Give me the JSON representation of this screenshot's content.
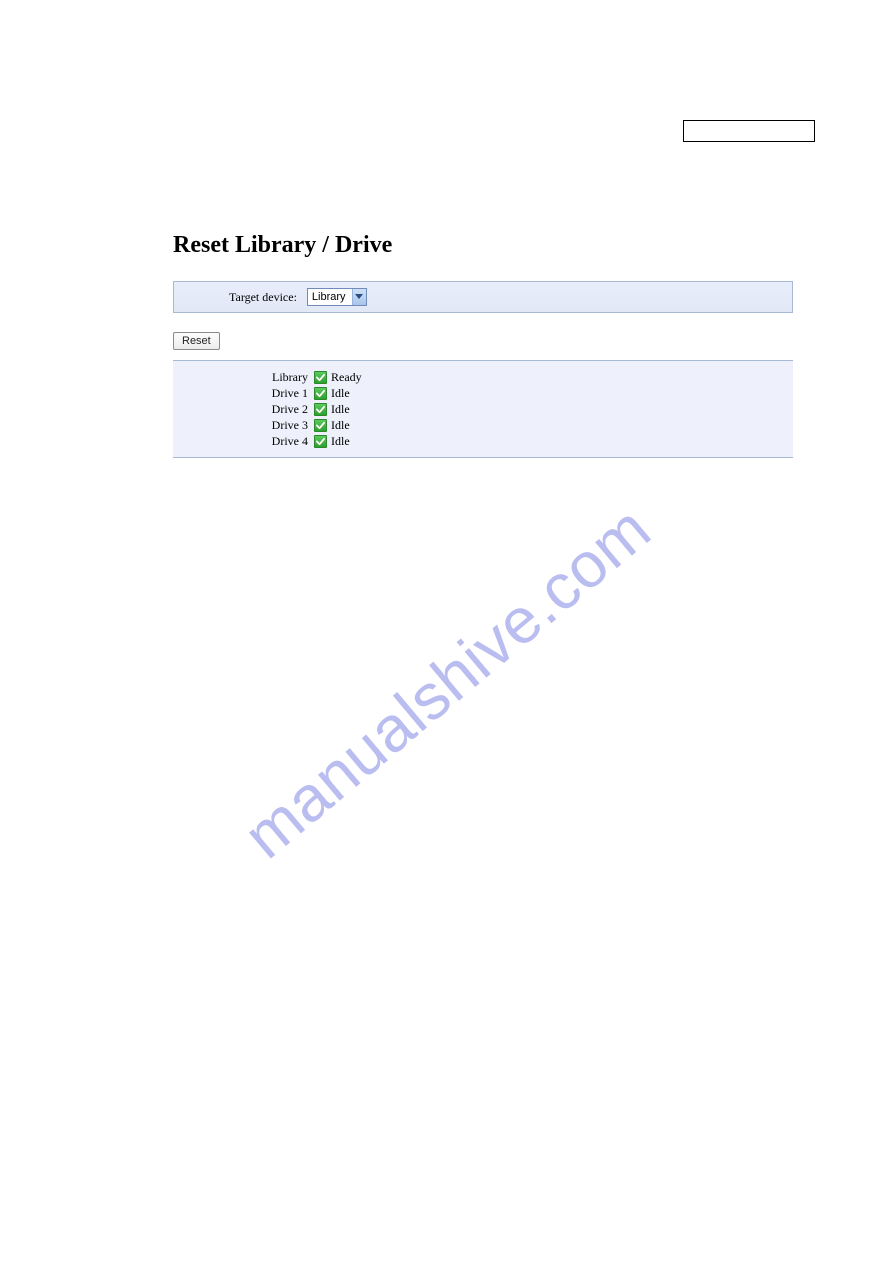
{
  "page_title": "Reset Library / Drive",
  "target": {
    "label": "Target device:",
    "selected": "Library"
  },
  "reset_button": "Reset",
  "status_rows": [
    {
      "label": "Library",
      "value": "Ready"
    },
    {
      "label": "Drive 1",
      "value": "Idle"
    },
    {
      "label": "Drive 2",
      "value": "Idle"
    },
    {
      "label": "Drive 3",
      "value": "Idle"
    },
    {
      "label": "Drive 4",
      "value": "Idle"
    }
  ],
  "watermark": "manualshive.com"
}
